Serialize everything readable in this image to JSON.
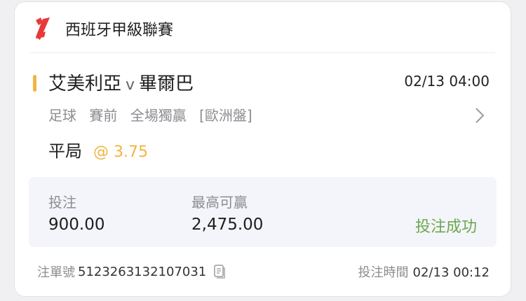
{
  "league": {
    "name": "西班牙甲級聯賽",
    "logo_icon": "laliga-logo-icon"
  },
  "match": {
    "home": "艾美利亞",
    "separator": "v",
    "away": "畢爾巴",
    "time": "02/13 04:00"
  },
  "meta": [
    "足球",
    "賽前",
    "全場獨贏",
    "[歐洲盤]"
  ],
  "selection": {
    "pick": "平局",
    "odds": "@ 3.75"
  },
  "stats": {
    "stake_label": "投注",
    "stake_value": "900.00",
    "max_win_label": "最高可贏",
    "max_win_value": "2,475.00",
    "status": "投注成功"
  },
  "footer": {
    "bet_no_label": "注單號",
    "bet_no_value": "5123263132107031",
    "bet_time_label": "投注時間",
    "bet_time_value": "02/13 00:12"
  },
  "colors": {
    "accent": "#f2b440",
    "success": "#6aa84f",
    "logo_red": "#e63a3a"
  }
}
